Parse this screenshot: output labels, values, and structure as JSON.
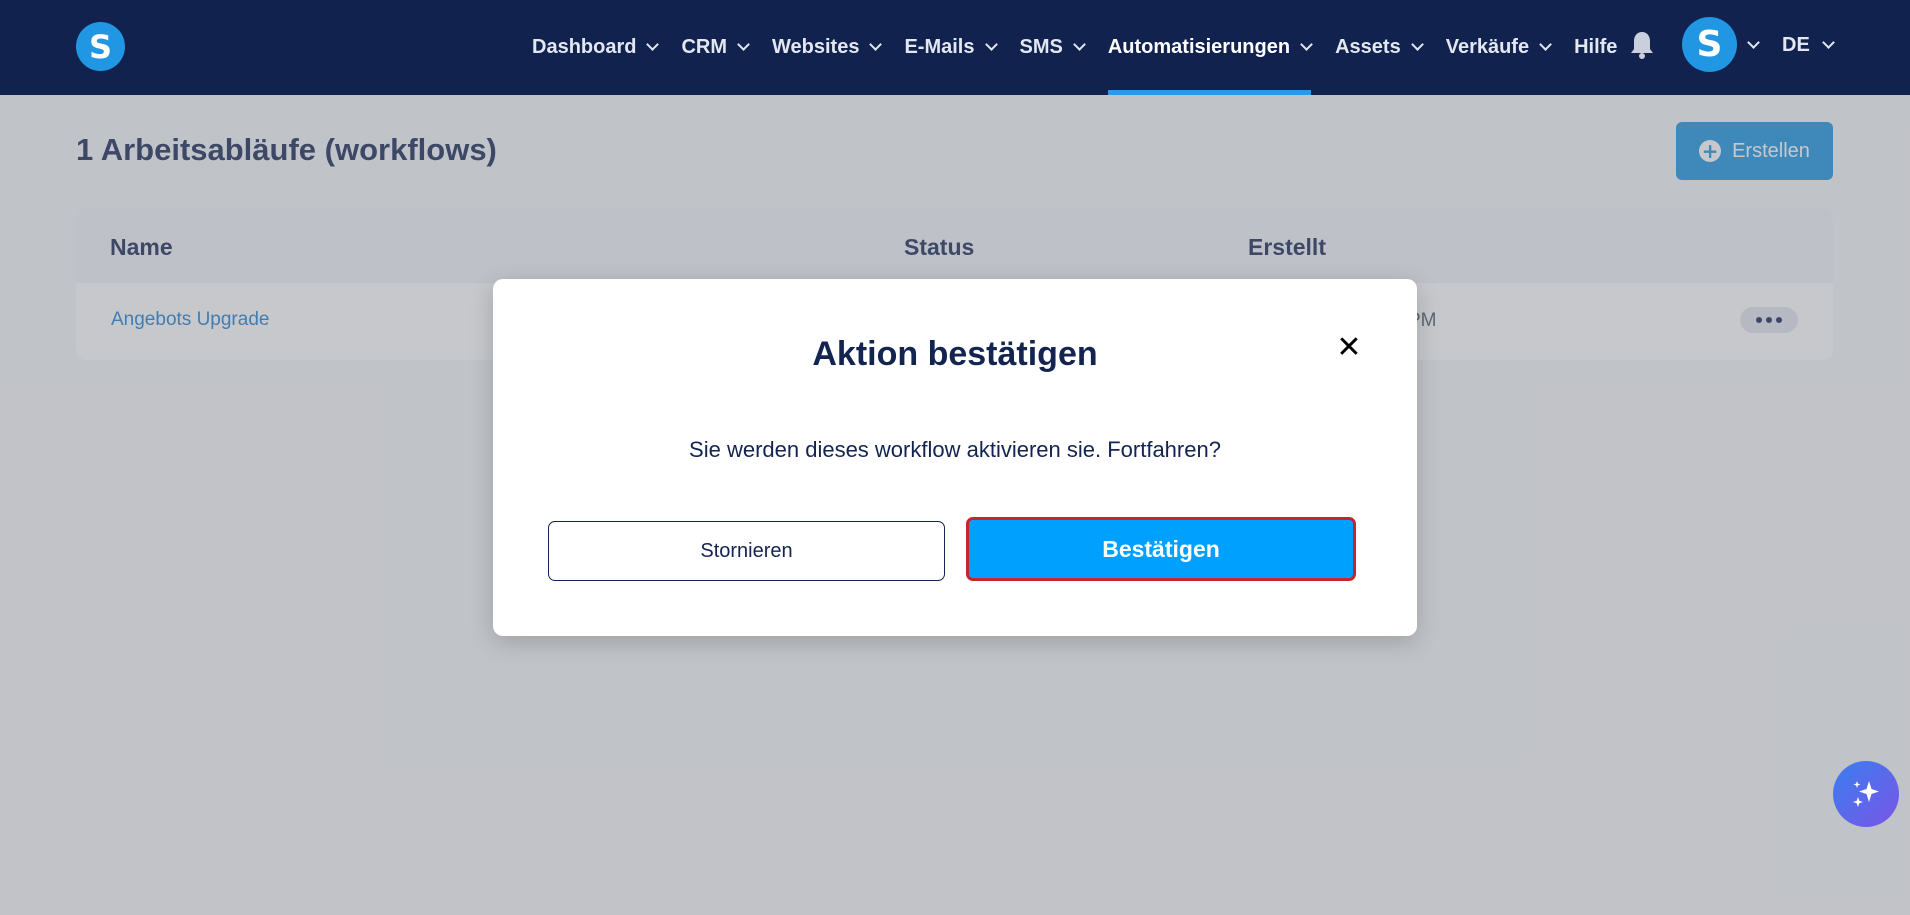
{
  "nav": {
    "logo_letter": "S",
    "items": [
      {
        "label": "Dashboard",
        "has_dropdown": true
      },
      {
        "label": "CRM",
        "has_dropdown": true
      },
      {
        "label": "Websites",
        "has_dropdown": true
      },
      {
        "label": "E-Mails",
        "has_dropdown": true
      },
      {
        "label": "SMS",
        "has_dropdown": true
      },
      {
        "label": "Automatisierungen",
        "has_dropdown": true,
        "active": true
      },
      {
        "label": "Assets",
        "has_dropdown": true
      },
      {
        "label": "Verkäufe",
        "has_dropdown": true
      },
      {
        "label": "Hilfe",
        "has_dropdown": false
      }
    ],
    "avatar_letter": "S",
    "language": "DE"
  },
  "page": {
    "title": "1 Arbeitsabläufe (workflows)",
    "create_label": "Erstellen",
    "create_icon": "plus-circle-icon"
  },
  "table": {
    "columns": [
      "Name",
      "Status",
      "Erstellt"
    ],
    "rows": [
      {
        "name": "Angebots Upgrade",
        "created": "PM"
      }
    ]
  },
  "modal": {
    "title": "Aktion bestätigen",
    "message": "Sie werden dieses workflow aktivieren sie. Fortfahren?",
    "cancel_label": "Stornieren",
    "confirm_label": "Bestätigen",
    "close_icon": "close-icon"
  },
  "colors": {
    "nav_bg": "#11224f",
    "accent": "#1693e0",
    "confirm_bg": "#00a0ff",
    "confirm_border": "#c4262b",
    "heading": "#132451"
  }
}
